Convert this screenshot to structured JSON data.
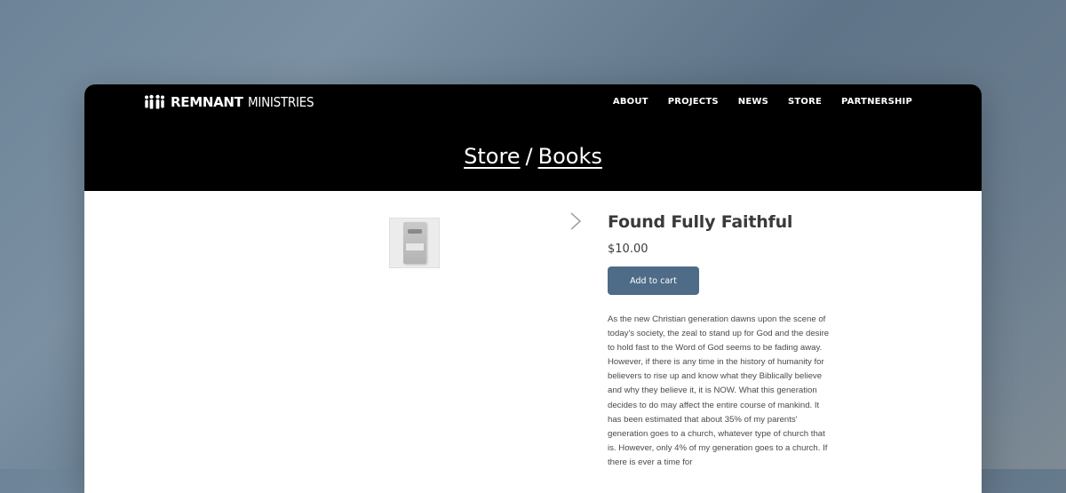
{
  "brand": {
    "logo_bold": "REMNANT",
    "logo_light": "MINISTRIES"
  },
  "nav": [
    "ABOUT",
    "PROJECTS",
    "NEWS",
    "STORE",
    "PARTNERSHIP"
  ],
  "breadcrumb": {
    "store": "Store",
    "separator": "/",
    "category": "Books"
  },
  "product": {
    "title": "Found Fully Faithful",
    "price": "$10.00",
    "add_to_cart": "Add to cart",
    "description": "As the new Christian generation dawns upon the scene of today's society, the zeal to stand up for God and the desire to hold fast to the Word of God seems to be fading away. However, if there is any time in the history of humanity for believers to rise up and know what they Biblically believe and why they believe it, it is NOW. What this generation decides to do may affect the entire course of mankind. It has been estimated that about 35% of my parents' generation goes to a church, whatever type of church that is. However, only 4% of my generation goes to a church. If there is ever a time for"
  },
  "colors": {
    "header_bg": "#000000",
    "button": "#4e6c87",
    "text": "#3a3a3a"
  }
}
